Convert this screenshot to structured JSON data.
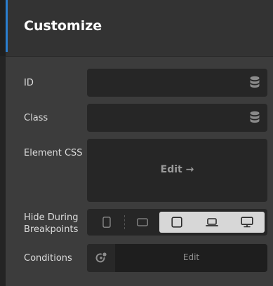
{
  "header": {
    "title": "Customize"
  },
  "fields": {
    "id_label": "ID",
    "class_label": "Class",
    "element_css_label": "Element CSS",
    "element_css_action": "Edit →",
    "hide_breakpoints_label_line1": "Hide During",
    "hide_breakpoints_label_line2": "Breakpoints",
    "conditions_label": "Conditions",
    "conditions_action": "Edit"
  },
  "breakpoints": [
    {
      "name": "mobile-portrait",
      "active": false
    },
    {
      "name": "tablet-landscape",
      "active": false
    },
    {
      "name": "tablet-portrait",
      "active": true
    },
    {
      "name": "laptop",
      "active": true
    },
    {
      "name": "desktop",
      "active": true
    }
  ],
  "icons": {
    "database": "database-icon",
    "conditions": "conditions-icon"
  },
  "colors": {
    "accent": "#2b7fd0",
    "active_breakpoint": "#d7d7d7"
  }
}
